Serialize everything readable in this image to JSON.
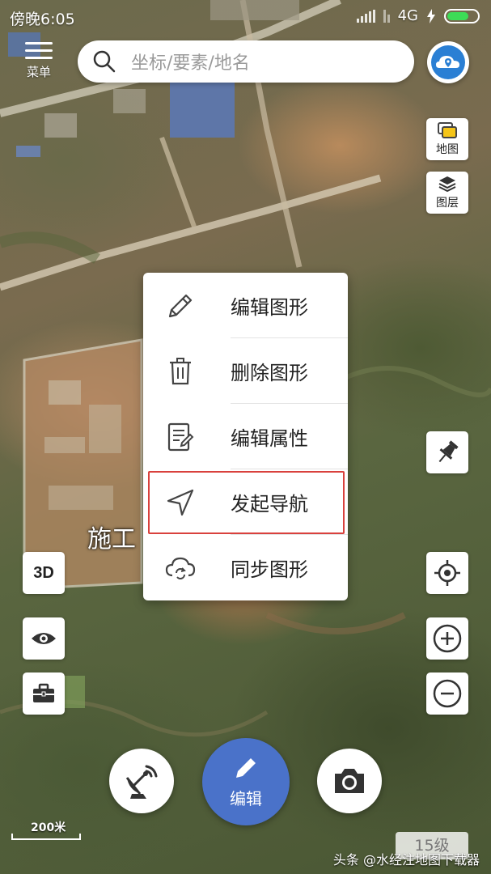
{
  "status_bar": {
    "time": "傍晚6:05",
    "network": "4G"
  },
  "header": {
    "menu_label": "菜单",
    "search_placeholder": "坐标/要素/地名"
  },
  "right_tools": {
    "map_label": "地图",
    "layer_label": "图层"
  },
  "left_tools": {
    "three_d_label": "3D"
  },
  "map": {
    "place_label": "施工"
  },
  "context_menu": {
    "items": [
      {
        "label": "编辑图形",
        "icon": "pencil-icon"
      },
      {
        "label": "删除图形",
        "icon": "trash-icon"
      },
      {
        "label": "编辑属性",
        "icon": "form-edit-icon"
      },
      {
        "label": "发起导航",
        "icon": "navigation-arrow-icon",
        "highlighted": true
      },
      {
        "label": "同步图形",
        "icon": "cloud-sync-icon"
      }
    ]
  },
  "bottom_actions": {
    "edit_label": "编辑"
  },
  "scale": {
    "label": "200米"
  },
  "zoom_level": "15级",
  "watermark": "头条 @水经注地图下载器",
  "colors": {
    "accent_blue": "#4a72c9",
    "highlight_red": "#d9413d",
    "battery_green": "#3ddc56"
  }
}
